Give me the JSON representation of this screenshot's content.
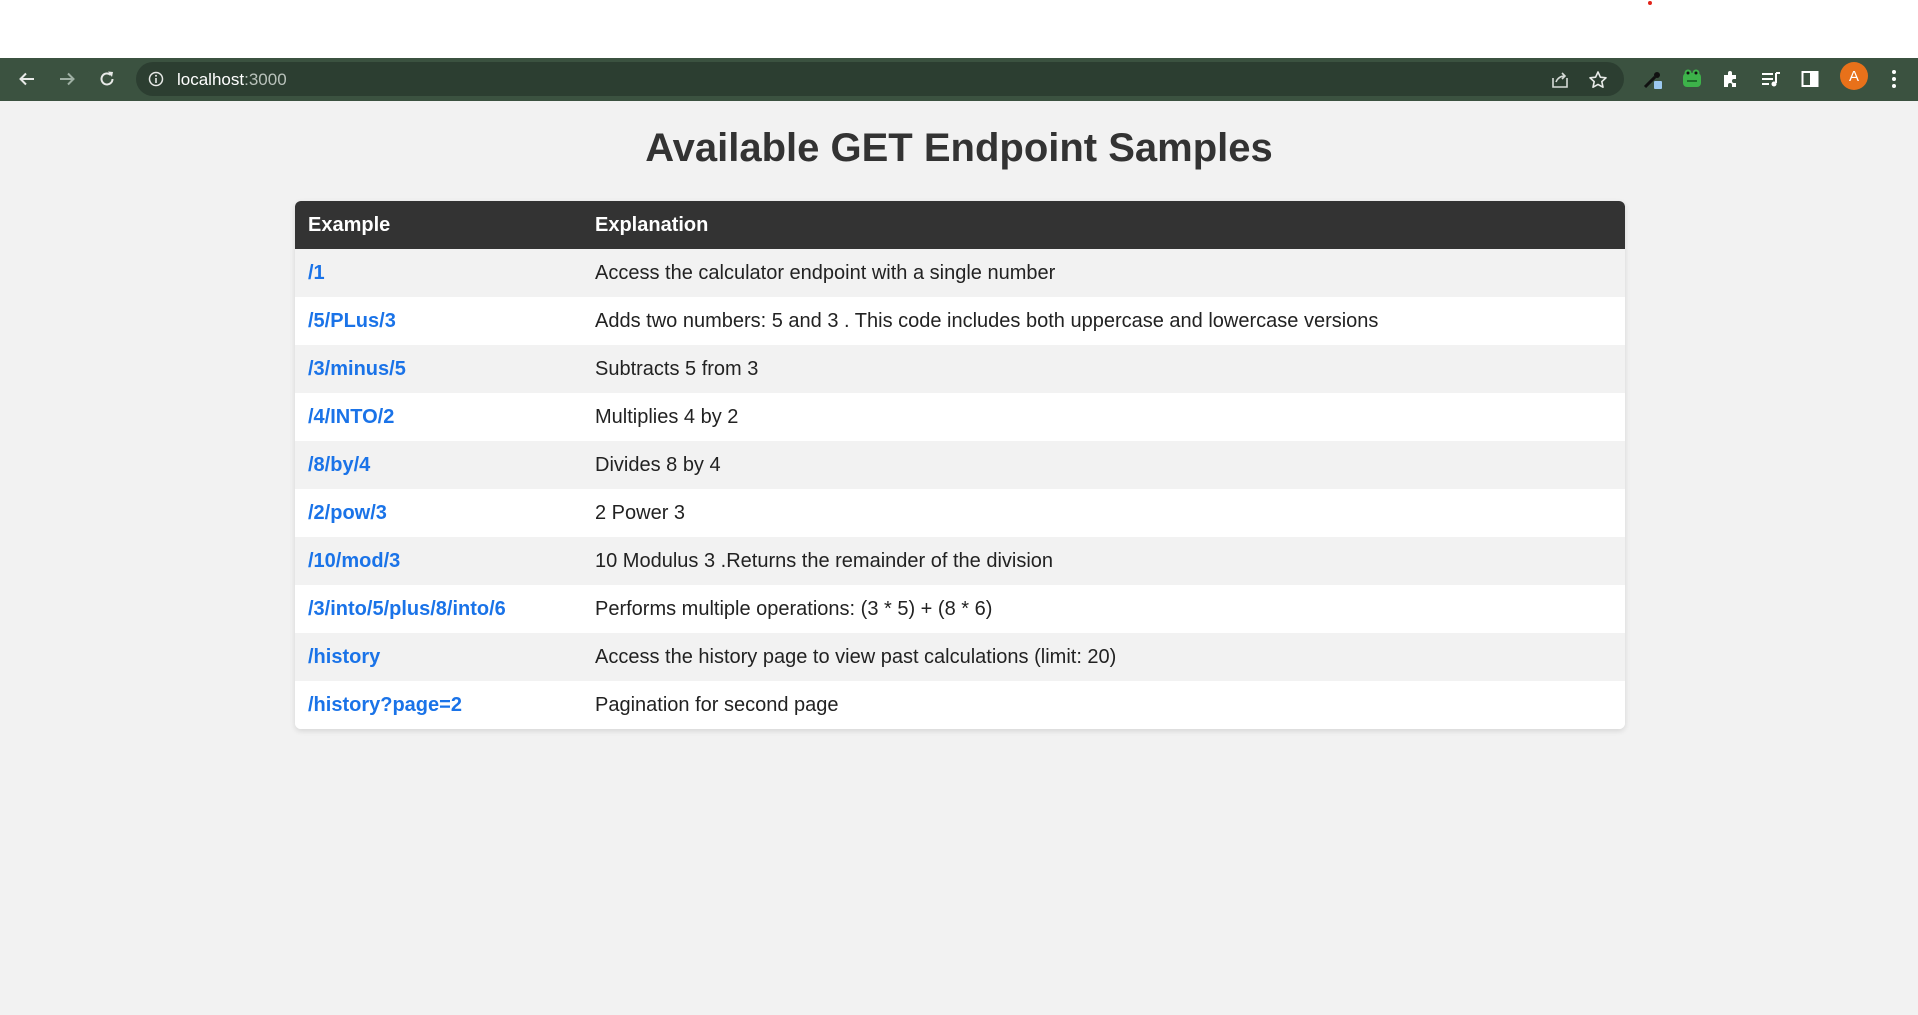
{
  "browser": {
    "url_host": "localhost",
    "url_port": ":3000",
    "avatar_letter": "A"
  },
  "page": {
    "title": "Available GET Endpoint Samples",
    "columns": [
      "Example",
      "Explanation"
    ],
    "rows": [
      {
        "example": "/1",
        "explanation": "Access the calculator endpoint with a single number"
      },
      {
        "example": "/5/PLus/3",
        "explanation": "Adds two numbers: 5 and 3 . This code includes both uppercase and lowercase versions"
      },
      {
        "example": "/3/minus/5",
        "explanation": "Subtracts 5 from 3"
      },
      {
        "example": "/4/INTO/2",
        "explanation": "Multiplies 4 by 2"
      },
      {
        "example": "/8/by/4",
        "explanation": "Divides 8 by 4"
      },
      {
        "example": "/2/pow/3",
        "explanation": "2 Power 3"
      },
      {
        "example": "/10/mod/3",
        "explanation": "10 Modulus 3 .Returns the remainder of the division"
      },
      {
        "example": "/3/into/5/plus/8/into/6",
        "explanation": "Performs multiple operations: (3 * 5) + (8 * 6)"
      },
      {
        "example": "/history",
        "explanation": "Access the history page to view past calculations (limit: 20)"
      },
      {
        "example": "/history?page=2",
        "explanation": "Pagination for second page"
      }
    ]
  },
  "icons": [
    "back-icon",
    "forward-icon",
    "reload-icon",
    "info-icon",
    "share-icon",
    "star-icon",
    "eyedropper-extension-icon",
    "frog-extension-icon",
    "puzzle-icon",
    "reading-list-icon",
    "side-panel-icon",
    "avatar",
    "menu-icon"
  ],
  "colors": {
    "toolbar": "#3b5240",
    "omnibox": "#2c3e31",
    "header_row": "#333333",
    "link": "#1a73e8",
    "background": "#f2f2f2",
    "avatar": "#e8711a"
  }
}
